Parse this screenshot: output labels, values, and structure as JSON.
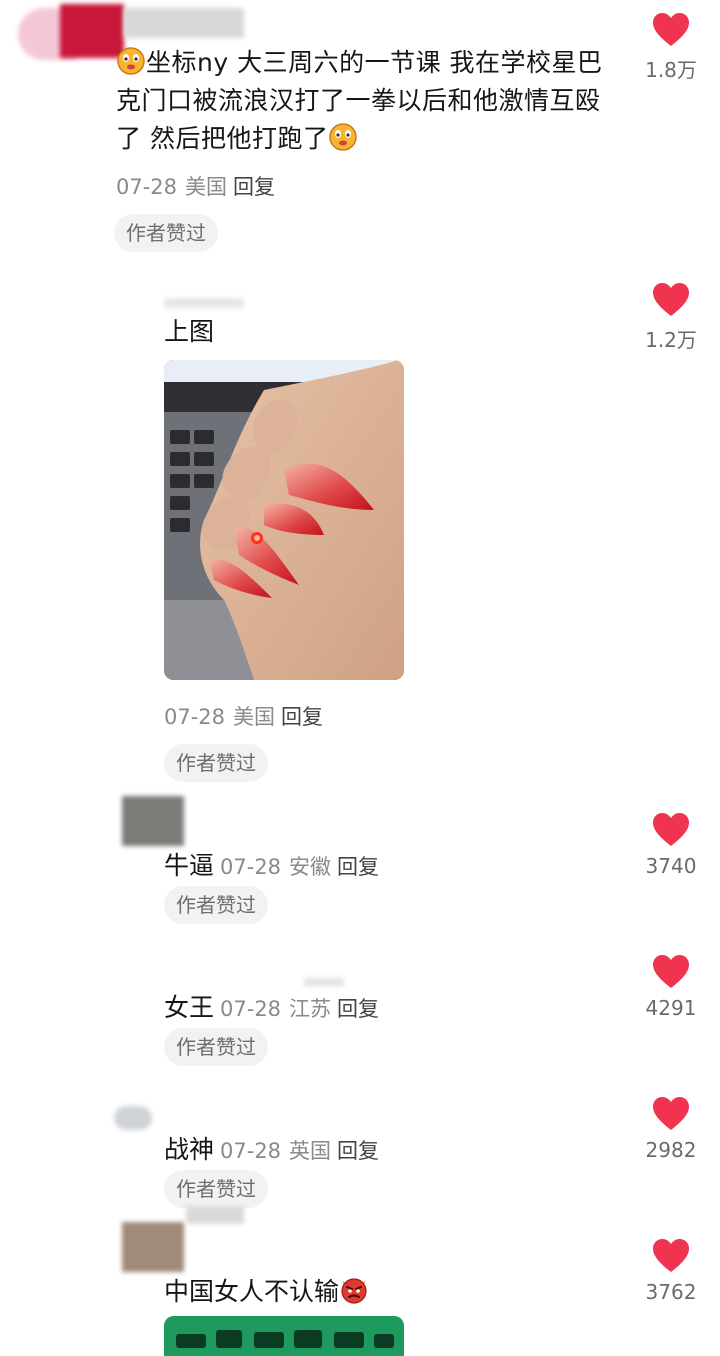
{
  "comments": [
    {
      "text_before": "坐标ny 大三周六的一节课 我在学校星巴克门口被流浪汉打了一拳以后和他激情互殴了 然后把他打跑了",
      "date": "07-28",
      "location": "美国",
      "reply": "回复",
      "author_liked": "作者赞过",
      "likes": "1.8万"
    },
    {
      "text": "上图",
      "date": "07-28",
      "location": "美国",
      "reply": "回复",
      "author_liked": "作者赞过",
      "likes": "1.2万"
    },
    {
      "text": "牛逼",
      "date": "07-28",
      "location": "安徽",
      "reply": "回复",
      "author_liked": "作者赞过",
      "likes": "3740"
    },
    {
      "text": "女王",
      "date": "07-28",
      "location": "江苏",
      "reply": "回复",
      "author_liked": "作者赞过",
      "likes": "4291"
    },
    {
      "text": "战神",
      "date": "07-28",
      "location": "英国",
      "reply": "回复",
      "author_liked": "作者赞过",
      "likes": "2982"
    },
    {
      "text": "中国女人不认输",
      "likes": "3762"
    }
  ],
  "colors": {
    "heart": "#f0334f",
    "accent_nail": "#d8232f"
  },
  "icons": {
    "like": "heart-icon",
    "emoji_laugh": "laughing-face-icon",
    "emoji_angry": "angry-devil-icon"
  }
}
